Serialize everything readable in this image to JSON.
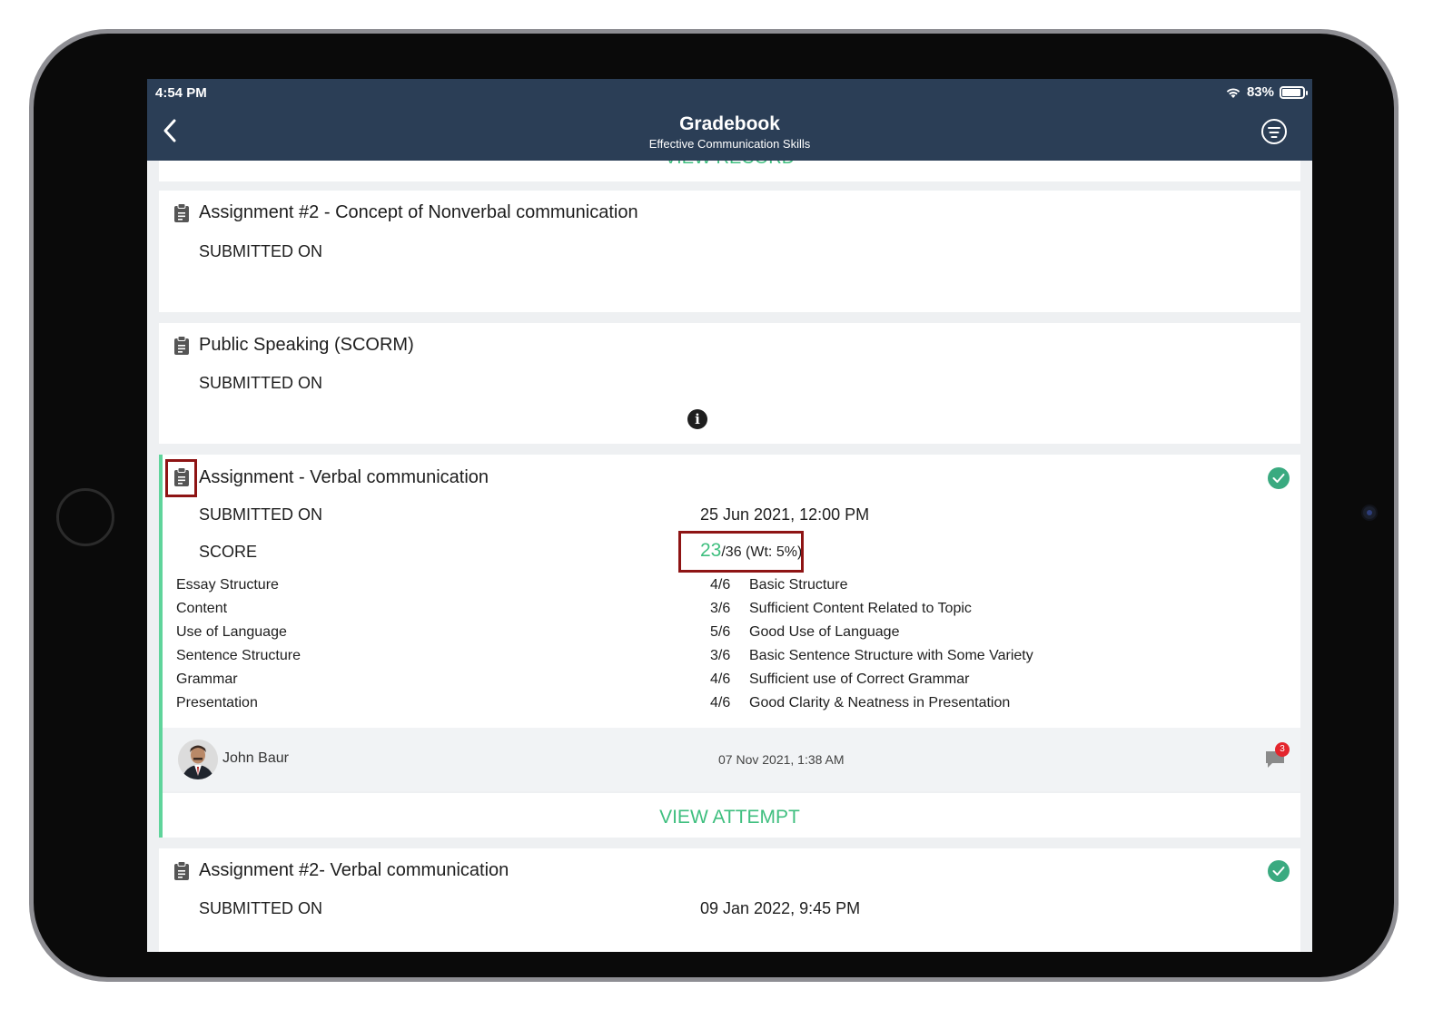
{
  "status_bar": {
    "time": "4:54 PM",
    "battery_percent": "83%",
    "battery_level": 0.83
  },
  "nav": {
    "title": "Gradebook",
    "subtitle": "Effective Communication Skills"
  },
  "top_card": {
    "view_record_label": "VIEW RECORD"
  },
  "assignments": [
    {
      "title": "Assignment #2 - Concept of Nonverbal communication",
      "submitted_label": "SUBMITTED ON"
    },
    {
      "title": "Public Speaking (SCORM)",
      "submitted_label": "SUBMITTED ON"
    },
    {
      "title": "Assignment - Verbal communication",
      "submitted_label": "SUBMITTED ON",
      "submitted_value": "25 Jun 2021, 12:00 PM",
      "score_label": "SCORE",
      "score_value": "23",
      "score_rest": "/36 (Wt: 5%)",
      "rubric": [
        {
          "name": "Essay Structure",
          "score": "4/6",
          "desc": "Basic Structure"
        },
        {
          "name": "Content",
          "score": "3/6",
          "desc": "Sufficient Content Related to Topic"
        },
        {
          "name": "Use of Language",
          "score": "5/6",
          "desc": "Good Use of Language"
        },
        {
          "name": "Sentence Structure",
          "score": "3/6",
          "desc": "Basic Sentence Structure with Some Variety"
        },
        {
          "name": "Grammar",
          "score": "4/6",
          "desc": "Sufficient use of Correct Grammar"
        },
        {
          "name": "Presentation",
          "score": "4/6",
          "desc": "Good Clarity & Neatness in Presentation"
        }
      ],
      "grader_name": "John Baur",
      "graded_date": "07 Nov 2021, 1:38 AM",
      "comment_count": "3",
      "view_attempt_label": "VIEW ATTEMPT"
    },
    {
      "title": "Assignment #2- Verbal communication",
      "submitted_label": "SUBMITTED ON",
      "submitted_value": "09 Jan 2022, 9:45 PM"
    }
  ],
  "colors": {
    "header": "#2b3e56",
    "accent_green": "#3fbf7f",
    "check_green": "#3aaa80",
    "highlight_red": "#8e1414",
    "badge_red": "#e4252d"
  },
  "icons": [
    "back-chevron-icon",
    "filter-icon",
    "clipboard-icon",
    "info-icon",
    "check-circle-icon",
    "comment-icon",
    "wifi-icon",
    "battery-icon"
  ]
}
